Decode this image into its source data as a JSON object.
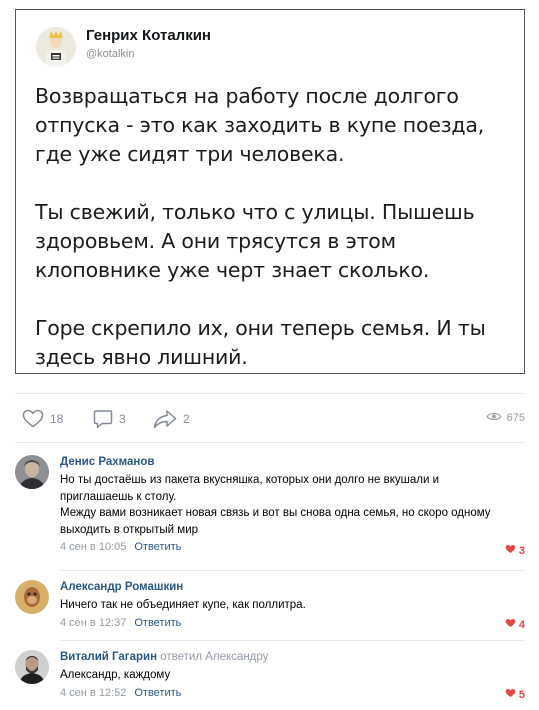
{
  "tweet": {
    "author_name": "Генрих Коталкин",
    "author_handle": "@kotalkin",
    "paragraphs": [
      "Возвращаться на работу после долгого отпуска - это как заходить в купе поезда, где уже сидят три человека.",
      "Ты свежий, только что с улицы. Пышешь здоровьем. А они трясутся в этом клоповнике уже черт знает сколько.",
      "Горе скрепило их, они теперь семья. И ты здесь явно лишний."
    ]
  },
  "post_actions": {
    "likes": "18",
    "comments": "3",
    "shares": "2",
    "views": "675"
  },
  "comments": [
    {
      "author": "Денис Рахманов",
      "replied_to": "",
      "text": "Но ты достаёшь из пакета вкусняшка, которых они долго не вкушали и приглашаешь к столу.\nМежду вами возникает новая связь и вот вы снова одна семья, но скоро одному выходить в открытый мир",
      "date": "4 сен в 10:05",
      "reply_label": "Ответить",
      "likes": "3"
    },
    {
      "author": "Александр Ромашкин",
      "replied_to": "",
      "text": "Ничего так не объединяет купе, как поллитра.",
      "date": "4 сен в 12:37",
      "reply_label": "Ответить",
      "likes": "4"
    },
    {
      "author": "Виталий Гагарин",
      "replied_to": "ответил Александру",
      "text": "Александр, каждому",
      "date": "4 сен в 12:52",
      "reply_label": "Ответить",
      "likes": "5"
    }
  ],
  "icons": {
    "like": "heart-outline-icon",
    "comment": "speech-bubble-icon",
    "share": "share-arrow-icon",
    "views": "eye-icon",
    "comment_like": "heart-filled-icon"
  },
  "colors": {
    "link": "#2a5885",
    "muted": "#939aa5",
    "like_red": "#e64646"
  }
}
